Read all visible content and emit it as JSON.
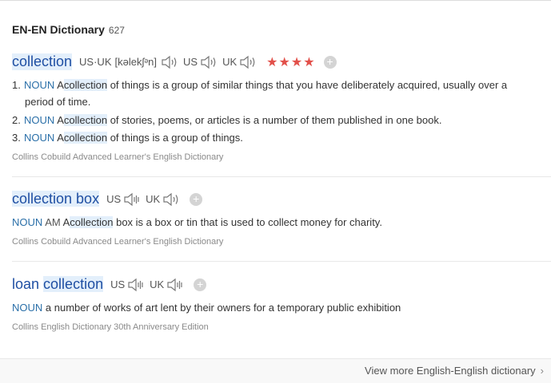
{
  "header": {
    "title": "EN-EN Dictionary",
    "count": "627"
  },
  "entries": [
    {
      "headword": "collection",
      "pron": [
        {
          "label": "US·UK",
          "phonetic": "[kəlekʃᵊn]"
        },
        {
          "label": "US"
        },
        {
          "label": "UK"
        }
      ],
      "stars": "★★★★",
      "definitions": [
        {
          "num": "1.",
          "pos": "NOUN",
          "pre": "A",
          "hl": "collection",
          "post": "of things is a group of similar things that you have deliberately acquired, usually over a",
          "cont": "period of time."
        },
        {
          "num": "2.",
          "pos": "NOUN",
          "pre": "A",
          "hl": "collection",
          "post": "of stories, poems, or articles is a number of them published in one book."
        },
        {
          "num": "3.",
          "pos": "NOUN",
          "pre": "A",
          "hl": "collection",
          "post": "of things is a group of things."
        }
      ],
      "source": "Collins Cobuild Advanced Learner's English Dictionary"
    },
    {
      "headword": "collection box",
      "pron": [
        {
          "label": "US"
        },
        {
          "label": "UK"
        }
      ],
      "definitions": [
        {
          "pos": "NOUN",
          "tag": "AM",
          "pre": "A",
          "hl": "collection",
          "post": "box is a box or tin that is used to collect money for charity."
        }
      ],
      "source": "Collins Cobuild Advanced Learner's English Dictionary"
    },
    {
      "headword_plain": "loan",
      "headword_hl": "collection",
      "pron": [
        {
          "label": "US"
        },
        {
          "label": "UK"
        }
      ],
      "definitions": [
        {
          "pos": "NOUN",
          "text": "a number of works of art lent by their owners for a temporary public exhibition"
        }
      ],
      "source": "Collins English Dictionary 30th Anniversary Edition"
    }
  ],
  "footer": {
    "more_label": "View more English-English dictionary"
  },
  "icons": {
    "speaker": "speaker-icon",
    "add": "add-icon",
    "chevron": "chevron-right-icon"
  },
  "colors": {
    "headword": "#1f4fa3",
    "stars": "#e2504a",
    "highlight": "#e3effb",
    "pos": "#2a6fa8"
  }
}
